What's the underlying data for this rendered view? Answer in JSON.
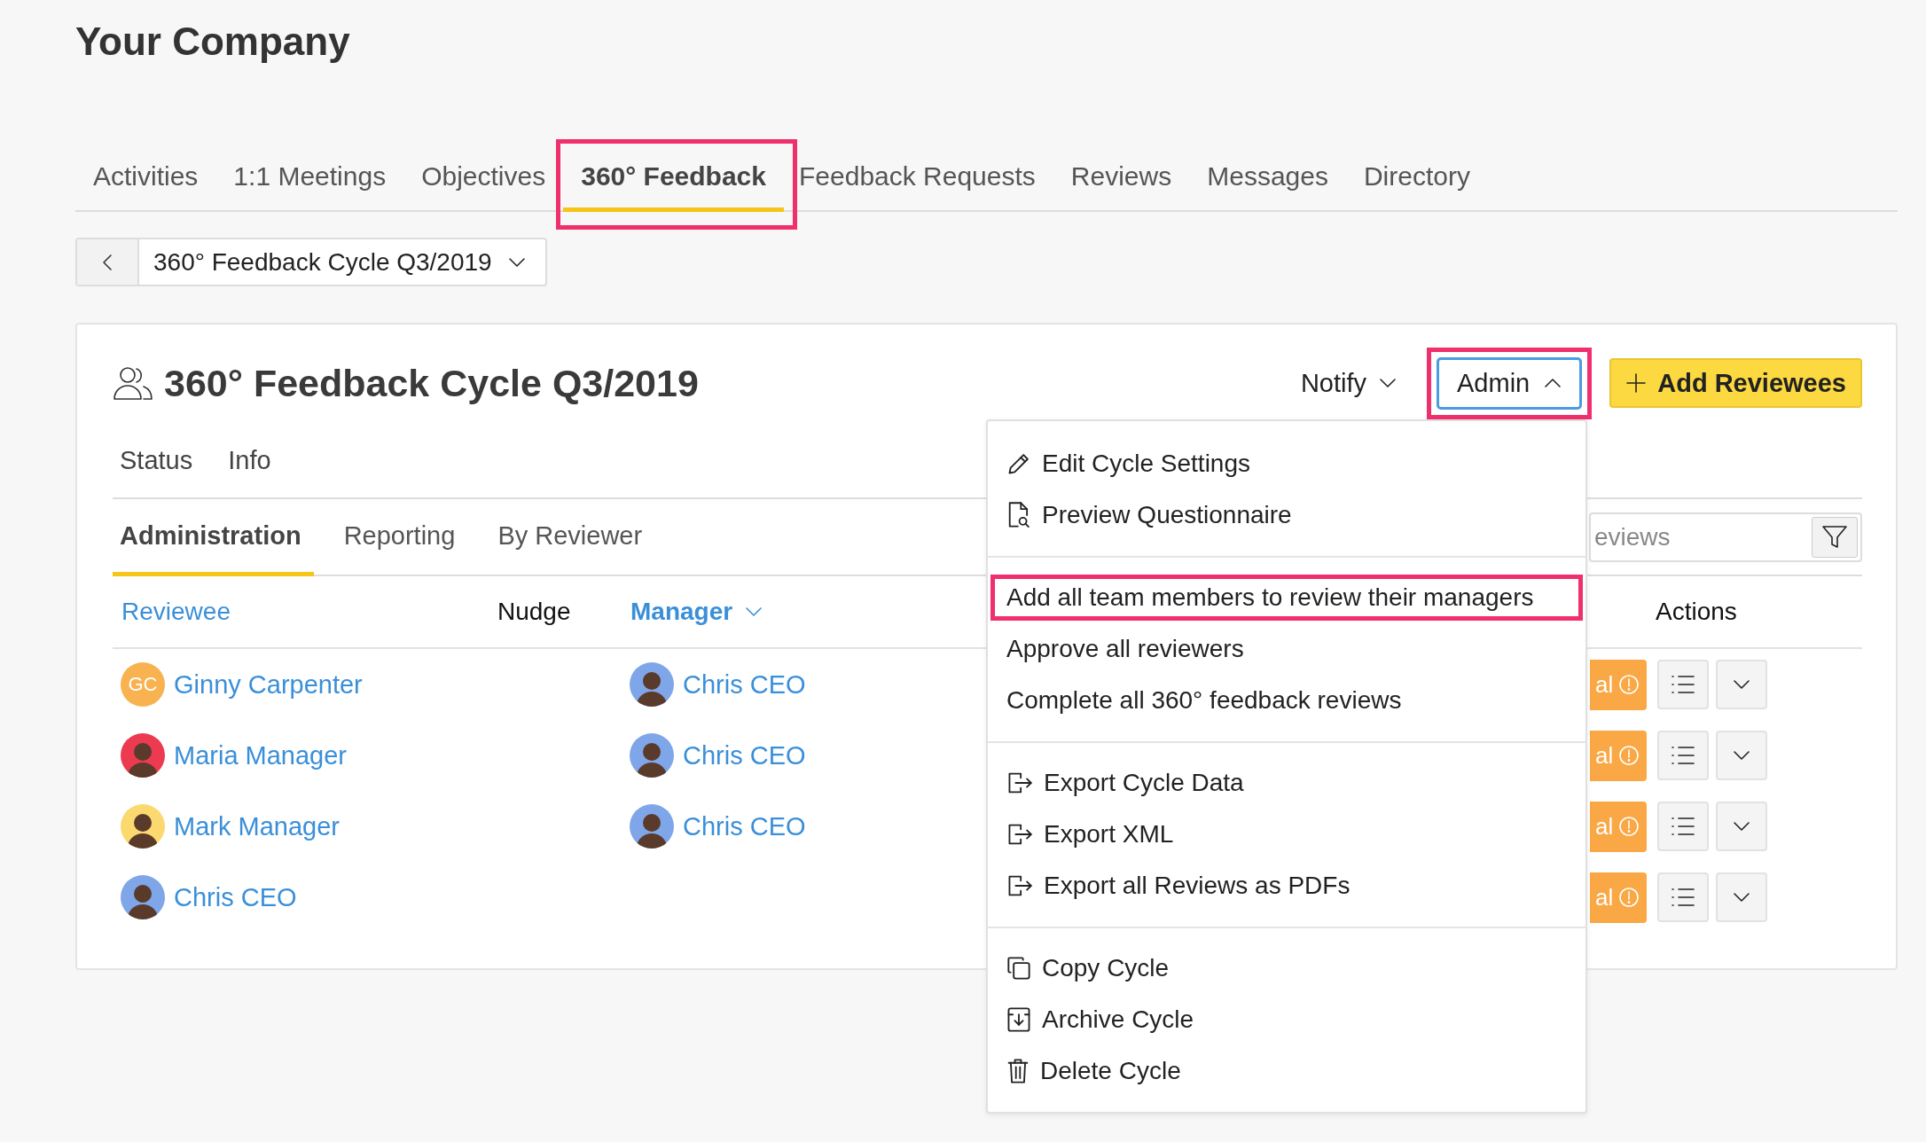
{
  "company": "Your Company",
  "nav_tabs": [
    {
      "label": "Activities",
      "selected": false,
      "highlighted": false
    },
    {
      "label": "1:1 Meetings",
      "selected": false,
      "highlighted": false
    },
    {
      "label": "Objectives",
      "selected": false,
      "highlighted": false
    },
    {
      "label": "360° Feedback",
      "selected": true,
      "highlighted": true
    },
    {
      "label": "Feedback Requests",
      "selected": false,
      "highlighted": false
    },
    {
      "label": "Reviews",
      "selected": false,
      "highlighted": false
    },
    {
      "label": "Messages",
      "selected": false,
      "highlighted": false
    },
    {
      "label": "Directory",
      "selected": false,
      "highlighted": false
    }
  ],
  "cycle_selector": {
    "label": "360° Feedback Cycle Q3/2019"
  },
  "card": {
    "title": "360° Feedback Cycle Q3/2019",
    "notify": "Notify",
    "admin": {
      "label": "Admin",
      "expanded": true,
      "highlighted": true
    },
    "add_button": "Add Reviewees",
    "section_links": [
      "Status",
      "Info"
    ],
    "view_tabs": [
      {
        "label": "Administration",
        "selected": true
      },
      {
        "label": "Reporting",
        "selected": false
      },
      {
        "label": "By Reviewer",
        "selected": false
      }
    ],
    "search": {
      "placeholder": "eviews"
    },
    "columns": [
      {
        "label": "Reviewee",
        "kind": "link"
      },
      {
        "label": "Nudge",
        "kind": "plain"
      },
      {
        "label": "Manager",
        "kind": "sorted"
      },
      {
        "label": "Actions",
        "kind": "plain"
      }
    ],
    "rows": [
      {
        "reviewee": {
          "name": "Ginny Carpenter",
          "avatar": {
            "kind": "initials",
            "initials": "GC",
            "color": "#f9b250"
          }
        },
        "manager": {
          "name": "Chris CEO",
          "avatar": {
            "kind": "illustration",
            "color": "#7ea6e8"
          }
        },
        "status": "al"
      },
      {
        "reviewee": {
          "name": "Maria Manager",
          "avatar": {
            "kind": "illustration",
            "color": "#ec3a50"
          }
        },
        "manager": {
          "name": "Chris CEO",
          "avatar": {
            "kind": "illustration",
            "color": "#7ea6e8"
          }
        },
        "status": "al"
      },
      {
        "reviewee": {
          "name": "Mark Manager",
          "avatar": {
            "kind": "illustration",
            "color": "#fbd96e"
          }
        },
        "manager": {
          "name": "Chris CEO",
          "avatar": {
            "kind": "illustration",
            "color": "#7ea6e8"
          }
        },
        "status": "al"
      },
      {
        "reviewee": {
          "name": "Chris CEO",
          "avatar": {
            "kind": "illustration",
            "color": "#7ea6e8"
          }
        },
        "status": "al"
      }
    ]
  },
  "admin_menu": [
    [
      {
        "label": "Edit Cycle Settings",
        "kind": "pencil",
        "highlighted": false
      },
      {
        "label": "Preview Questionnaire",
        "kind": "document-search",
        "highlighted": false
      }
    ],
    [
      {
        "label": "Add all team members to review their managers",
        "highlighted": true
      },
      {
        "label": "Approve all reviewers",
        "highlighted": false
      },
      {
        "label": "Complete all 360° feedback reviews",
        "highlighted": false
      }
    ],
    [
      {
        "label": "Export Cycle Data",
        "kind": "export",
        "highlighted": false
      },
      {
        "label": "Export XML",
        "kind": "export",
        "highlighted": false
      },
      {
        "label": "Export all Reviews as PDFs",
        "kind": "export",
        "highlighted": false
      }
    ],
    [
      {
        "label": "Copy Cycle",
        "kind": "copy",
        "highlighted": false
      },
      {
        "label": "Archive Cycle",
        "kind": "archive",
        "highlighted": false
      },
      {
        "label": "Delete Cycle",
        "kind": "trash",
        "highlighted": false
      }
    ]
  ]
}
